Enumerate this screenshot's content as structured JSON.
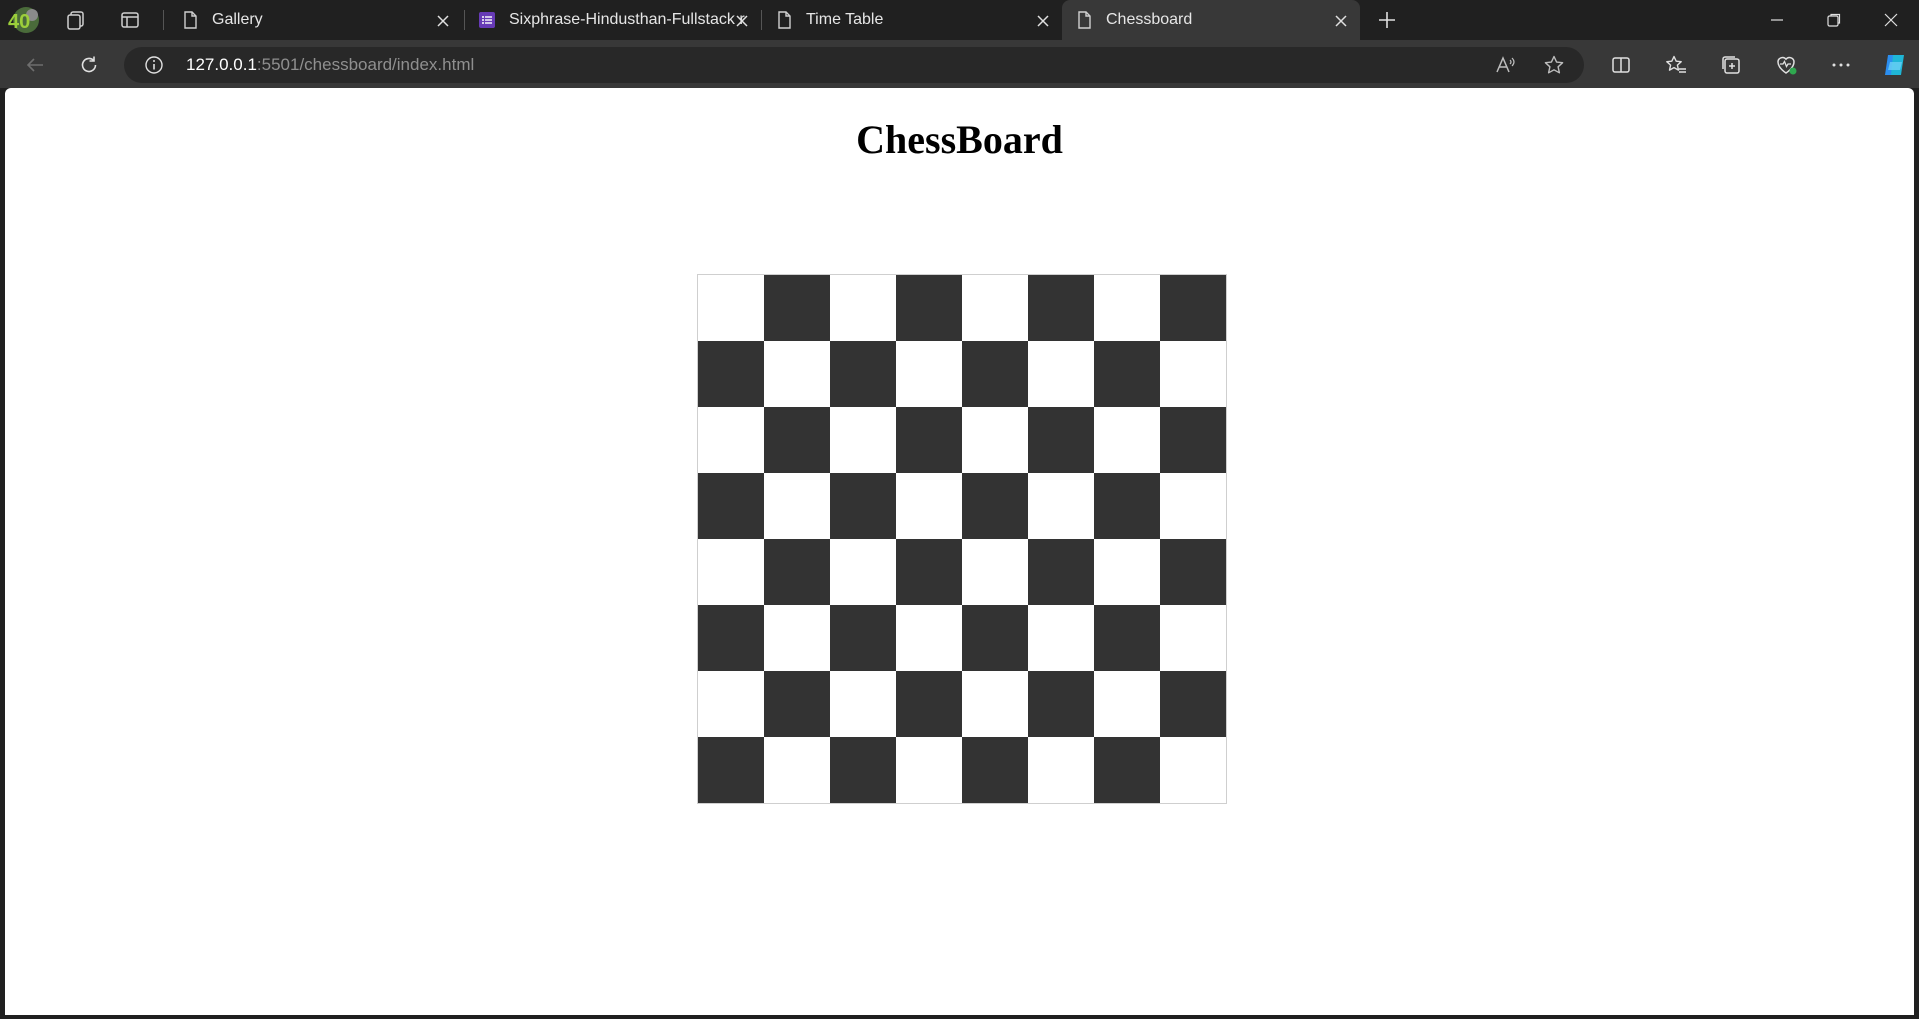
{
  "browser": {
    "tabs": [
      {
        "title": "Gallery",
        "active": false
      },
      {
        "title": "Sixphrase-Hindusthan-Fullstack r",
        "active": false
      },
      {
        "title": "Time Table",
        "active": false
      },
      {
        "title": "Chessboard",
        "active": true
      }
    ],
    "address": {
      "host": "127.0.0.1",
      "rest": ":5501/chessboard/index.html"
    },
    "profile_badge": "40",
    "icons": [
      "workspaces-icon",
      "tab-actions-icon",
      "new-tab-icon",
      "minimize-icon",
      "restore-icon",
      "close-window-icon",
      "back-icon",
      "refresh-icon",
      "site-info-icon",
      "read-aloud-icon",
      "favorite-star-icon",
      "split-screen-icon",
      "favorites-icon",
      "collections-icon",
      "browser-essentials-icon",
      "more-icon",
      "copilot-icon"
    ]
  },
  "page": {
    "title": "ChessBoard",
    "board": {
      "rows": 8,
      "cols": 8,
      "top_left_color": "light",
      "light_color": "#ffffff",
      "dark_color": "#333333"
    }
  }
}
